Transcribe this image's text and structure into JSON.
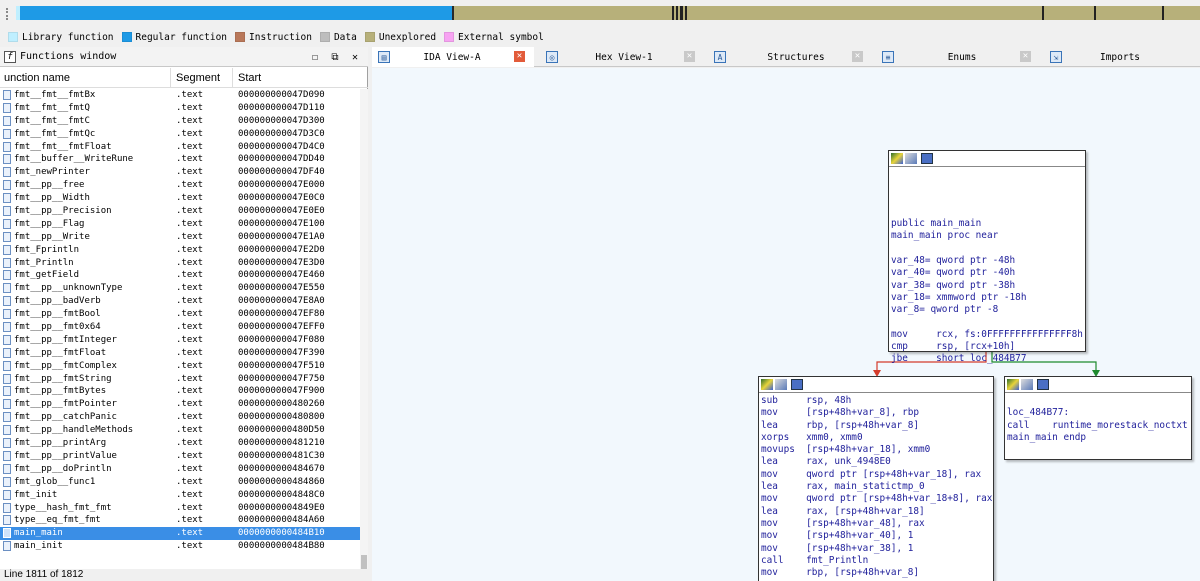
{
  "legend": [
    {
      "label": "Library function",
      "color": "#bfefff"
    },
    {
      "label": "Regular function",
      "color": "#1e9ae6"
    },
    {
      "label": "Instruction",
      "color": "#b9785a"
    },
    {
      "label": "Data",
      "color": "#bdbdbd"
    },
    {
      "label": "Unexplored",
      "color": "#b7b07a"
    },
    {
      "label": "External symbol",
      "color": "#f7a3f2"
    }
  ],
  "functions_window": {
    "title": "Functions window",
    "columns": [
      "unction name",
      "Segment",
      "Start"
    ],
    "rows": [
      {
        "name": "fmt__fmt__fmtBx",
        "segment": ".text",
        "start": "000000000047D090"
      },
      {
        "name": "fmt__fmt__fmtQ",
        "segment": ".text",
        "start": "000000000047D110"
      },
      {
        "name": "fmt__fmt__fmtC",
        "segment": ".text",
        "start": "000000000047D300"
      },
      {
        "name": "fmt__fmt__fmtQc",
        "segment": ".text",
        "start": "000000000047D3C0"
      },
      {
        "name": "fmt__fmt__fmtFloat",
        "segment": ".text",
        "start": "000000000047D4C0"
      },
      {
        "name": "fmt__buffer__WriteRune",
        "segment": ".text",
        "start": "000000000047DD40"
      },
      {
        "name": "fmt_newPrinter",
        "segment": ".text",
        "start": "000000000047DF40"
      },
      {
        "name": "fmt__pp__free",
        "segment": ".text",
        "start": "000000000047E000"
      },
      {
        "name": "fmt__pp__Width",
        "segment": ".text",
        "start": "000000000047E0C0"
      },
      {
        "name": "fmt__pp__Precision",
        "segment": ".text",
        "start": "000000000047E0E0"
      },
      {
        "name": "fmt__pp__Flag",
        "segment": ".text",
        "start": "000000000047E100"
      },
      {
        "name": "fmt__pp__Write",
        "segment": ".text",
        "start": "000000000047E1A0"
      },
      {
        "name": "fmt_Fprintln",
        "segment": ".text",
        "start": "000000000047E2D0"
      },
      {
        "name": "fmt_Println",
        "segment": ".text",
        "start": "000000000047E3D0"
      },
      {
        "name": "fmt_getField",
        "segment": ".text",
        "start": "000000000047E460"
      },
      {
        "name": "fmt__pp__unknownType",
        "segment": ".text",
        "start": "000000000047E550"
      },
      {
        "name": "fmt__pp__badVerb",
        "segment": ".text",
        "start": "000000000047E8A0"
      },
      {
        "name": "fmt__pp__fmtBool",
        "segment": ".text",
        "start": "000000000047EF80"
      },
      {
        "name": "fmt__pp__fmt0x64",
        "segment": ".text",
        "start": "000000000047EFF0"
      },
      {
        "name": "fmt__pp__fmtInteger",
        "segment": ".text",
        "start": "000000000047F080"
      },
      {
        "name": "fmt__pp__fmtFloat",
        "segment": ".text",
        "start": "000000000047F390"
      },
      {
        "name": "fmt__pp__fmtComplex",
        "segment": ".text",
        "start": "000000000047F510"
      },
      {
        "name": "fmt__pp__fmtString",
        "segment": ".text",
        "start": "000000000047F750"
      },
      {
        "name": "fmt__pp__fmtBytes",
        "segment": ".text",
        "start": "000000000047F900"
      },
      {
        "name": "fmt__pp__fmtPointer",
        "segment": ".text",
        "start": "0000000000480260"
      },
      {
        "name": "fmt__pp__catchPanic",
        "segment": ".text",
        "start": "0000000000480800"
      },
      {
        "name": "fmt__pp__handleMethods",
        "segment": ".text",
        "start": "0000000000480D50"
      },
      {
        "name": "fmt__pp__printArg",
        "segment": ".text",
        "start": "0000000000481210"
      },
      {
        "name": "fmt__pp__printValue",
        "segment": ".text",
        "start": "0000000000481C30"
      },
      {
        "name": "fmt__pp__doPrintln",
        "segment": ".text",
        "start": "0000000000484670"
      },
      {
        "name": "fmt_glob__func1",
        "segment": ".text",
        "start": "0000000000484860"
      },
      {
        "name": "fmt_init",
        "segment": ".text",
        "start": "00000000004848C0"
      },
      {
        "name": "type__hash_fmt_fmt",
        "segment": ".text",
        "start": "00000000004849E0"
      },
      {
        "name": "type__eq_fmt_fmt",
        "segment": ".text",
        "start": "0000000000484A60"
      },
      {
        "name": "main_main",
        "segment": ".text",
        "start": "0000000000484B10",
        "selected": true
      },
      {
        "name": "main_init",
        "segment": ".text",
        "start": "0000000000484B80"
      }
    ],
    "status": "Line 1811 of 1812"
  },
  "tabs": [
    {
      "label": "IDA View-A",
      "icon": "ida-view-icon",
      "active": true
    },
    {
      "label": "Hex View-1",
      "icon": "hex-view-icon",
      "active": false
    },
    {
      "label": "Structures",
      "icon": "structures-icon",
      "active": false
    },
    {
      "label": "Enums",
      "icon": "enums-icon",
      "active": false
    },
    {
      "label": "Imports",
      "icon": "imports-icon",
      "active": false
    }
  ],
  "graph": {
    "node_top": {
      "lines": [
        {
          "t": ""
        },
        {
          "t": ""
        },
        {
          "t": ""
        },
        {
          "t": ""
        },
        {
          "t": "public main_main"
        },
        {
          "t": "main_main proc near"
        },
        {
          "t": ""
        },
        {
          "t": "var_48= qword ptr -48h"
        },
        {
          "t": "var_40= qword ptr -40h"
        },
        {
          "t": "var_38= qword ptr -38h"
        },
        {
          "t": "var_18= xmmword ptr -18h"
        },
        {
          "t": "var_8= qword ptr -8"
        },
        {
          "t": ""
        },
        {
          "t": "mov     rcx, fs:0FFFFFFFFFFFFFFF8h"
        },
        {
          "t": "cmp     rsp, [rcx+10h]"
        },
        {
          "t": "jbe     short loc_484B77"
        }
      ]
    },
    "node_left": {
      "lines": [
        {
          "t": "sub     rsp, 48h"
        },
        {
          "t": "mov     [rsp+48h+var_8], rbp"
        },
        {
          "t": "lea     rbp, [rsp+48h+var_8]"
        },
        {
          "t": "xorps   xmm0, xmm0"
        },
        {
          "t": "movups  [rsp+48h+var_18], xmm0"
        },
        {
          "t": "lea     rax, unk_4948E0"
        },
        {
          "t": "mov     qword ptr [rsp+48h+var_18], rax"
        },
        {
          "t": "lea     rax, main_statictmp_0"
        },
        {
          "t": "mov     qword ptr [rsp+48h+var_18+8], rax"
        },
        {
          "t": "lea     rax, [rsp+48h+var_18]"
        },
        {
          "t": "mov     [rsp+48h+var_48], rax"
        },
        {
          "t": "mov     [rsp+48h+var_40], 1"
        },
        {
          "t": "mov     [rsp+48h+var_38], 1"
        },
        {
          "t": "call    fmt_Println"
        },
        {
          "t": "mov     rbp, [rsp+48h+var_8]"
        }
      ]
    },
    "node_right": {
      "lines": [
        {
          "t": ""
        },
        {
          "t": "loc_484B77:"
        },
        {
          "t": "call    runtime_morestack_noctxt"
        },
        {
          "t": "main_main endp"
        }
      ]
    }
  },
  "colors": {
    "edge_false": "#d43c2c",
    "edge_true": "#1e8a2e",
    "selection": "#3a8ee6",
    "graph_bg": "#f2f8fd"
  }
}
